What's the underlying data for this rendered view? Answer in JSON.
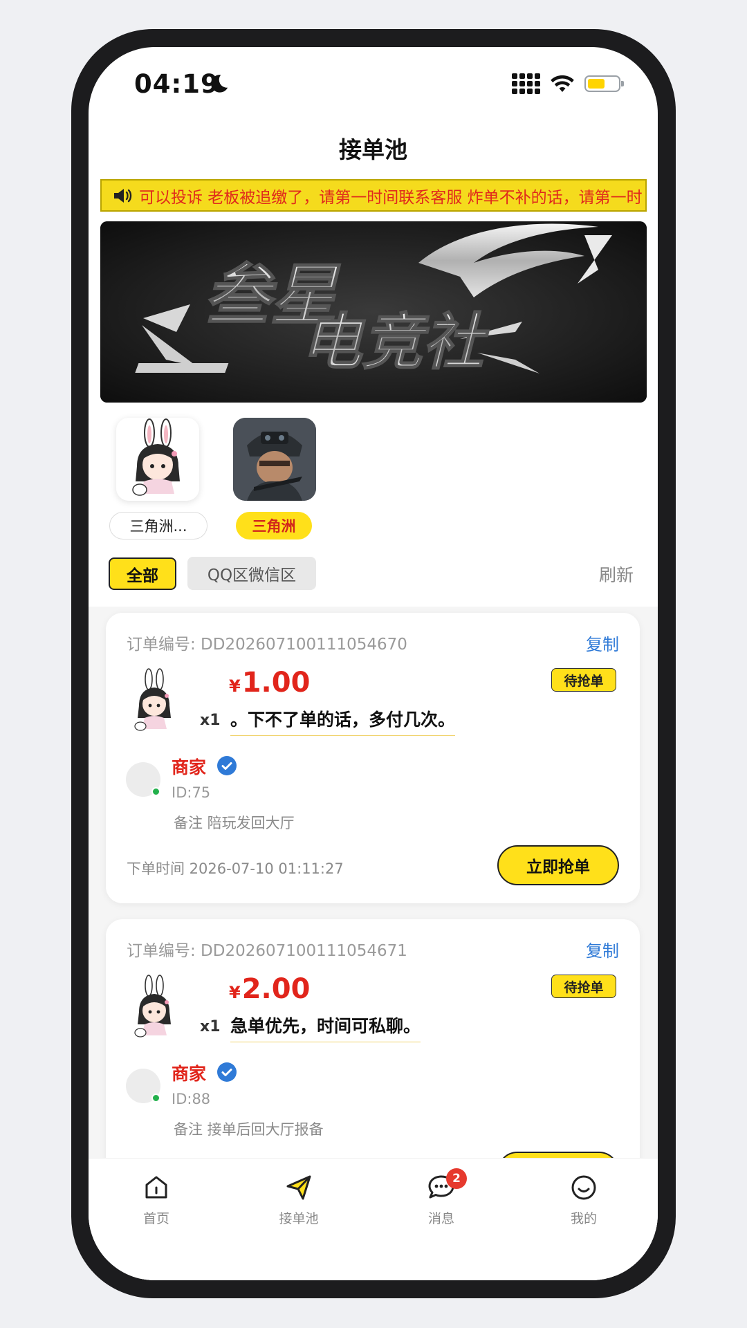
{
  "status_bar": {
    "time": "04:19"
  },
  "header": {
    "title": "接单池"
  },
  "notice": {
    "text": "可以投诉 老板被追缴了，请第一时间联系客服 炸单不补的话，请第一时"
  },
  "banner": {
    "text_line1": "叁星",
    "text_line2": "电竞社"
  },
  "games": [
    {
      "label": "三角洲...",
      "icon": "bunny-girl-avatar",
      "selected": false
    },
    {
      "label": "三角洲",
      "icon": "soldier-avatar",
      "selected": true
    }
  ],
  "filters": {
    "all": "全部",
    "qq_wechat": "QQ区微信区",
    "refresh": "刷新"
  },
  "orders": [
    {
      "order_no": "订单编号: DD202607100111054670",
      "copy": "复制",
      "currency": "¥",
      "price": "1.00",
      "status": "待抢单",
      "qty": "x1",
      "desc": "。下不了单的话，多付几次。",
      "merchant": "商家",
      "merchant_id": "ID:75",
      "remark": "备注 陪玩发回大厅",
      "order_time": "下单时间 2026-07-10 01:11:27",
      "grab": "立即抢单"
    },
    {
      "order_no": "订单编号: DD202607100111054671",
      "copy": "复制",
      "currency": "¥",
      "price": "2.00",
      "status": "待抢单",
      "qty": "x1",
      "desc": "急单优先，时间可私聊。",
      "merchant": "商家",
      "merchant_id": "ID:88",
      "remark": "备注 接单后回大厅报备"
    }
  ],
  "tabbar": [
    {
      "label": "首页",
      "icon": "home-icon"
    },
    {
      "label": "接单池",
      "icon": "send-icon",
      "active": true
    },
    {
      "label": "消息",
      "icon": "chat-icon",
      "badge": "2"
    },
    {
      "label": "我的",
      "icon": "smile-icon"
    }
  ],
  "colors": {
    "accent_yellow": "#ffe01a",
    "price_red": "#e1251b",
    "link_blue": "#2f7ad7"
  }
}
